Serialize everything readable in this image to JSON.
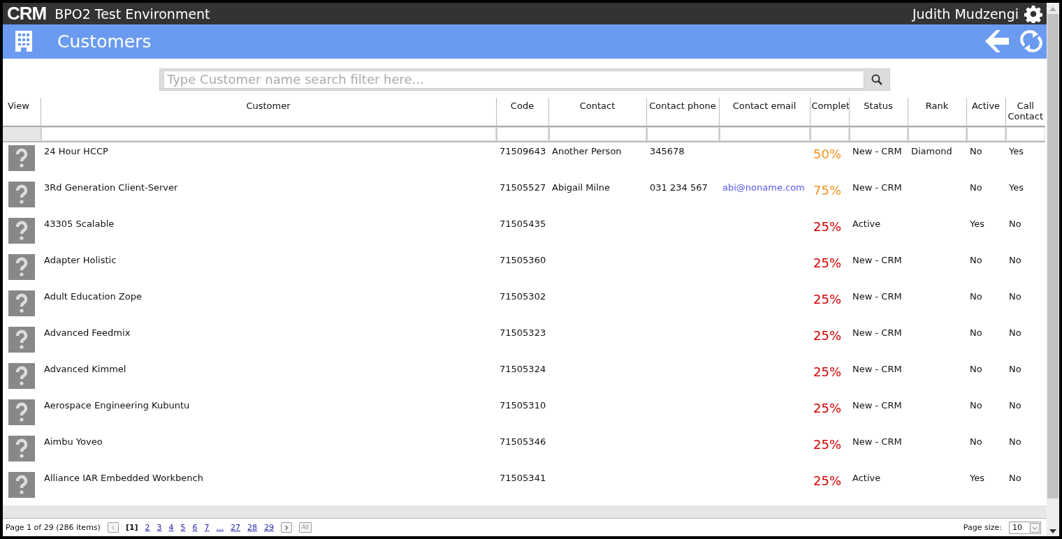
{
  "app": {
    "logo": "CRM",
    "title": "BPO2 Test Environment",
    "user": "Judith Mudzengi"
  },
  "page": {
    "title": "Customers"
  },
  "search": {
    "placeholder": "Type Customer name search filter here..."
  },
  "table": {
    "columns": [
      {
        "label": "View"
      },
      {
        "label": "Customer"
      },
      {
        "label": "Code"
      },
      {
        "label": "Contact"
      },
      {
        "label": "Contact phone"
      },
      {
        "label": "Contact email"
      },
      {
        "label": "Complet"
      },
      {
        "label": "Status"
      },
      {
        "label": "Rank"
      },
      {
        "label": "Active"
      },
      {
        "label": "Call Contact"
      }
    ],
    "rows": [
      {
        "customer": "24 Hour HCCP",
        "code": "71509643",
        "contact": "Another Person",
        "phone": "345678",
        "email": "",
        "complete": "50%",
        "color": "#f7931e",
        "status": "New - CRM",
        "rank": "Diamond",
        "active": "No",
        "call_contact": "Yes"
      },
      {
        "customer": "3Rd Generation Client-Server",
        "code": "71505527",
        "contact": "Abigail Milne",
        "phone": "031 234 567",
        "email": "abi@noname.com",
        "complete": "75%",
        "color": "#f7931e",
        "status": "New - CRM",
        "rank": "",
        "active": "No",
        "call_contact": "Yes"
      },
      {
        "customer": "43305 Scalable",
        "code": "71505435",
        "contact": "",
        "phone": "",
        "email": "",
        "complete": "25%",
        "color": "#d40000",
        "status": "Active",
        "rank": "",
        "active": "Yes",
        "call_contact": "No"
      },
      {
        "customer": "Adapter Holistic",
        "code": "71505360",
        "contact": "",
        "phone": "",
        "email": "",
        "complete": "25%",
        "color": "#d40000",
        "status": "New - CRM",
        "rank": "",
        "active": "No",
        "call_contact": "No"
      },
      {
        "customer": "Adult Education Zope",
        "code": "71505302",
        "contact": "",
        "phone": "",
        "email": "",
        "complete": "25%",
        "color": "#d40000",
        "status": "New - CRM",
        "rank": "",
        "active": "No",
        "call_contact": "No"
      },
      {
        "customer": "Advanced Feedmix",
        "code": "71505323",
        "contact": "",
        "phone": "",
        "email": "",
        "complete": "25%",
        "color": "#d40000",
        "status": "New - CRM",
        "rank": "",
        "active": "No",
        "call_contact": "No"
      },
      {
        "customer": "Advanced Kimmel",
        "code": "71505324",
        "contact": "",
        "phone": "",
        "email": "",
        "complete": "25%",
        "color": "#d40000",
        "status": "New - CRM",
        "rank": "",
        "active": "No",
        "call_contact": "No"
      },
      {
        "customer": "Aerospace Engineering Kubuntu",
        "code": "71505310",
        "contact": "",
        "phone": "",
        "email": "",
        "complete": "25%",
        "color": "#d40000",
        "status": "New - CRM",
        "rank": "",
        "active": "No",
        "call_contact": "No"
      },
      {
        "customer": "Aimbu Yoveo",
        "code": "71505346",
        "contact": "",
        "phone": "",
        "email": "",
        "complete": "25%",
        "color": "#d40000",
        "status": "New - CRM",
        "rank": "",
        "active": "No",
        "call_contact": "No"
      },
      {
        "customer": "Alliance IAR Embedded Workbench",
        "code": "71505341",
        "contact": "",
        "phone": "",
        "email": "",
        "complete": "25%",
        "color": "#d40000",
        "status": "Active",
        "rank": "",
        "active": "Yes",
        "call_contact": "No"
      }
    ]
  },
  "pager": {
    "summary": "Page 1 of 29 (286 items)",
    "pages": [
      {
        "label": "[1]",
        "selected": true
      },
      {
        "label": "2",
        "selected": false
      },
      {
        "label": "3",
        "selected": false
      },
      {
        "label": "4",
        "selected": false
      },
      {
        "label": "5",
        "selected": false
      },
      {
        "label": "6",
        "selected": false
      },
      {
        "label": "7",
        "selected": false
      },
      {
        "label": "...",
        "selected": false
      },
      {
        "label": "27",
        "selected": false
      },
      {
        "label": "28",
        "selected": false
      },
      {
        "label": "29",
        "selected": false
      }
    ],
    "all": "All",
    "page_size_label": "Page size:",
    "page_size": "10"
  }
}
